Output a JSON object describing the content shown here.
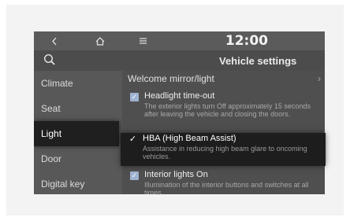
{
  "topbar": {
    "back_icon": "back-arrow-icon",
    "home_icon": "home-icon",
    "menu_icon": "menu-icon",
    "time": "12:00"
  },
  "header": {
    "search_icon": "search-icon",
    "title": "Vehicle settings"
  },
  "sidebar": {
    "items": [
      {
        "label": "Climate"
      },
      {
        "label": "Seat"
      },
      {
        "label": "Light"
      },
      {
        "label": "Door"
      },
      {
        "label": "Digital key"
      }
    ],
    "selected": "Light"
  },
  "content": {
    "welcome": {
      "label": "Welcome mirror/light"
    },
    "options": [
      {
        "title": "Headlight time-out",
        "desc": "The exterior lights turn Off approximately 15 seconds after leaving the vehicle and closing the doors.",
        "checked": true
      },
      {
        "title": "HBA (High Beam Assist)",
        "desc": "Assistance in reducing high beam glare to oncoming vehicles.",
        "checked": true
      },
      {
        "title": "Interior lights On",
        "desc": "Illumination of the interior buttons and switches at all times.",
        "checked": true
      }
    ]
  },
  "colors": {
    "checkbox": "#9fb3d1",
    "highlight": "#1d1d1d"
  }
}
